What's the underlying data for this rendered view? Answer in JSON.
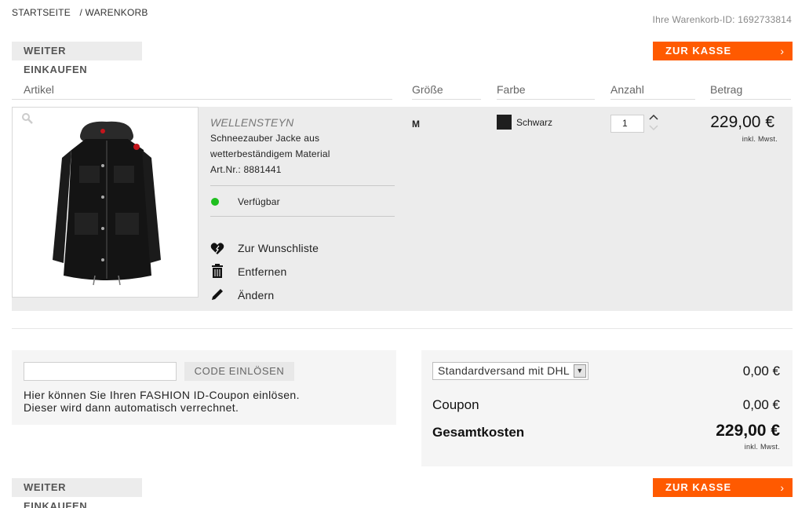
{
  "breadcrumb": {
    "home": "STARTSEITE",
    "current": "/ WARENKORB"
  },
  "cart_id": "Ihre Warenkorb-ID: 1692733814",
  "buttons": {
    "continue_shopping": "WEITER EINKAUFEN",
    "checkout": "ZUR KASSE",
    "checkout_arrow": "›",
    "redeem_code": "CODE EINLÖSEN"
  },
  "table_headers": {
    "article": "Artikel",
    "size": "Größe",
    "color": "Farbe",
    "quantity": "Anzahl",
    "amount": "Betrag"
  },
  "item": {
    "brand": "WELLENSTEYN",
    "desc_line1": "Schneezauber Jacke aus",
    "desc_line2": "wetterbeständigem Material",
    "article_no": "Art.Nr.: 8881441",
    "availability": "Verfügbar",
    "size": "M",
    "color": "Schwarz",
    "quantity": "1",
    "price": "229,00 €",
    "vat_note": "inkl. Mwst."
  },
  "actions": {
    "wishlist": "Zur Wunschliste",
    "remove": "Entfernen",
    "edit": "Ändern"
  },
  "coupon": {
    "input_value": "",
    "info": "Hier können Sie Ihren FASHION ID-Coupon einlösen. Dieser wird dann automatisch verrechnet."
  },
  "totals": {
    "shipping_option": "Standardversand mit DHL",
    "shipping_value": "0,00 €",
    "coupon_label": "Coupon",
    "coupon_value": "0,00 €",
    "total_label": "Gesamtkosten",
    "total_value": "229,00 €",
    "vat_note": "inkl. Mwst."
  },
  "colors": {
    "accent": "#ff5a00",
    "available": "#1fbf1f",
    "row_bg": "#ececec"
  },
  "icons": [
    "search-icon",
    "heart-icon",
    "trash-icon",
    "pencil-icon",
    "chevron-up-icon",
    "chevron-down-icon",
    "chevron-right-icon"
  ]
}
